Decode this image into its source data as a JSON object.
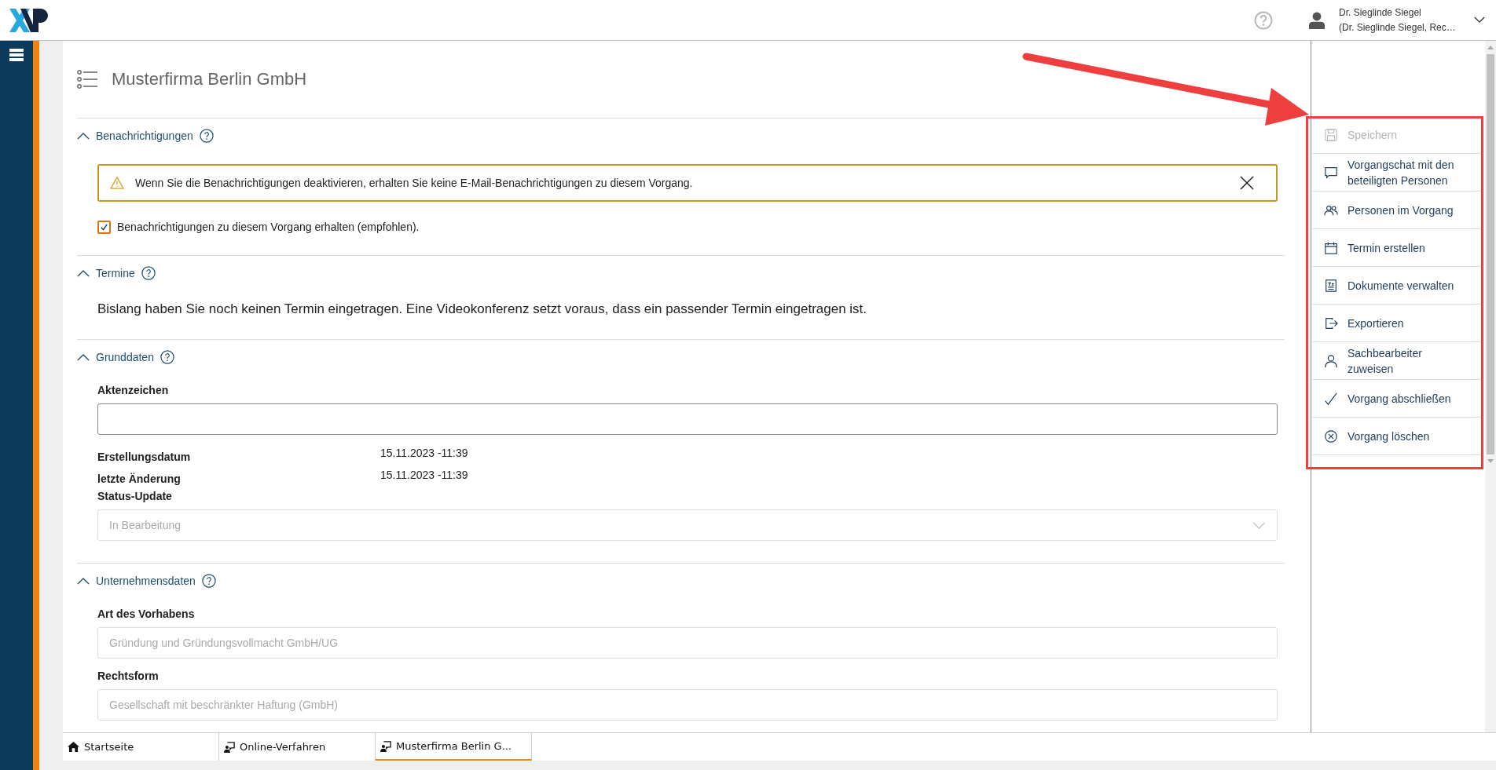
{
  "header": {
    "user": {
      "name": "Dr. Sieglinde Siegel",
      "role": "(Dr. Sieglinde Siegel, Rec…"
    }
  },
  "page_title": "Musterfirma Berlin GmbH",
  "sections": [
    {
      "title": "Benachrichtigungen",
      "expanded": true,
      "kind": "notifications",
      "alert": "Wenn Sie die Benachrichtigungen deaktivieren, erhalten Sie keine E-Mail-Benachrichtigungen zu diesem Vorgang.",
      "checkbox": {
        "label": "Benachrichtigungen zu diesem Vorgang erhalten (empfohlen).",
        "checked": true
      }
    },
    {
      "title": "Termine",
      "expanded": true,
      "kind": "text",
      "text": "Bislang haben Sie noch keinen Termin eingetragen. Eine Videokonferenz setzt voraus, dass ein passender Termin eingetragen ist."
    },
    {
      "title": "Grunddaten",
      "expanded": true,
      "kind": "fields",
      "fields": [
        {
          "kind": "input",
          "label": "Aktenzeichen",
          "disabled": false
        },
        {
          "kind": "info",
          "label": "Erstellungsdatum",
          "value": "15.11.2023 -11:39"
        },
        {
          "kind": "info",
          "label": "letzte Änderung",
          "value": "15.11.2023 -11:39"
        },
        {
          "kind": "select",
          "label": "Status-Update",
          "value": "In Bearbeitung",
          "disabled": true
        }
      ]
    },
    {
      "title": "Unternehmensdaten",
      "expanded": true,
      "kind": "fields",
      "fields": [
        {
          "kind": "input",
          "label": "Art des Vorhabens",
          "value": "Gründung und Gründungsvollmacht GmbH/UG",
          "disabled": true
        },
        {
          "kind": "input",
          "label": "Rechtsform",
          "value": "Gesellschaft mit beschränkter Haftung (GmbH)",
          "disabled": true
        }
      ]
    }
  ],
  "actions": [
    {
      "label": "Speichern",
      "disabled": true
    },
    {
      "label": "Vorgangschat mit den beteiligten Personen",
      "disabled": false
    },
    {
      "label": "Personen im Vorgang",
      "disabled": false
    },
    {
      "label": "Termin erstellen",
      "disabled": false
    },
    {
      "label": "Dokumente verwalten",
      "disabled": false
    },
    {
      "label": "Exportieren",
      "disabled": false
    },
    {
      "label": "Sachbearbeiter zuweisen",
      "disabled": false
    },
    {
      "label": "Vorgang abschließen",
      "disabled": false
    },
    {
      "label": "Vorgang löschen",
      "disabled": false
    }
  ],
  "tabs": [
    {
      "label": "Startseite",
      "selected": false
    },
    {
      "label": "Online-Verfahren",
      "selected": false
    },
    {
      "label": "Musterfirma Berlin G...",
      "selected": true
    }
  ]
}
